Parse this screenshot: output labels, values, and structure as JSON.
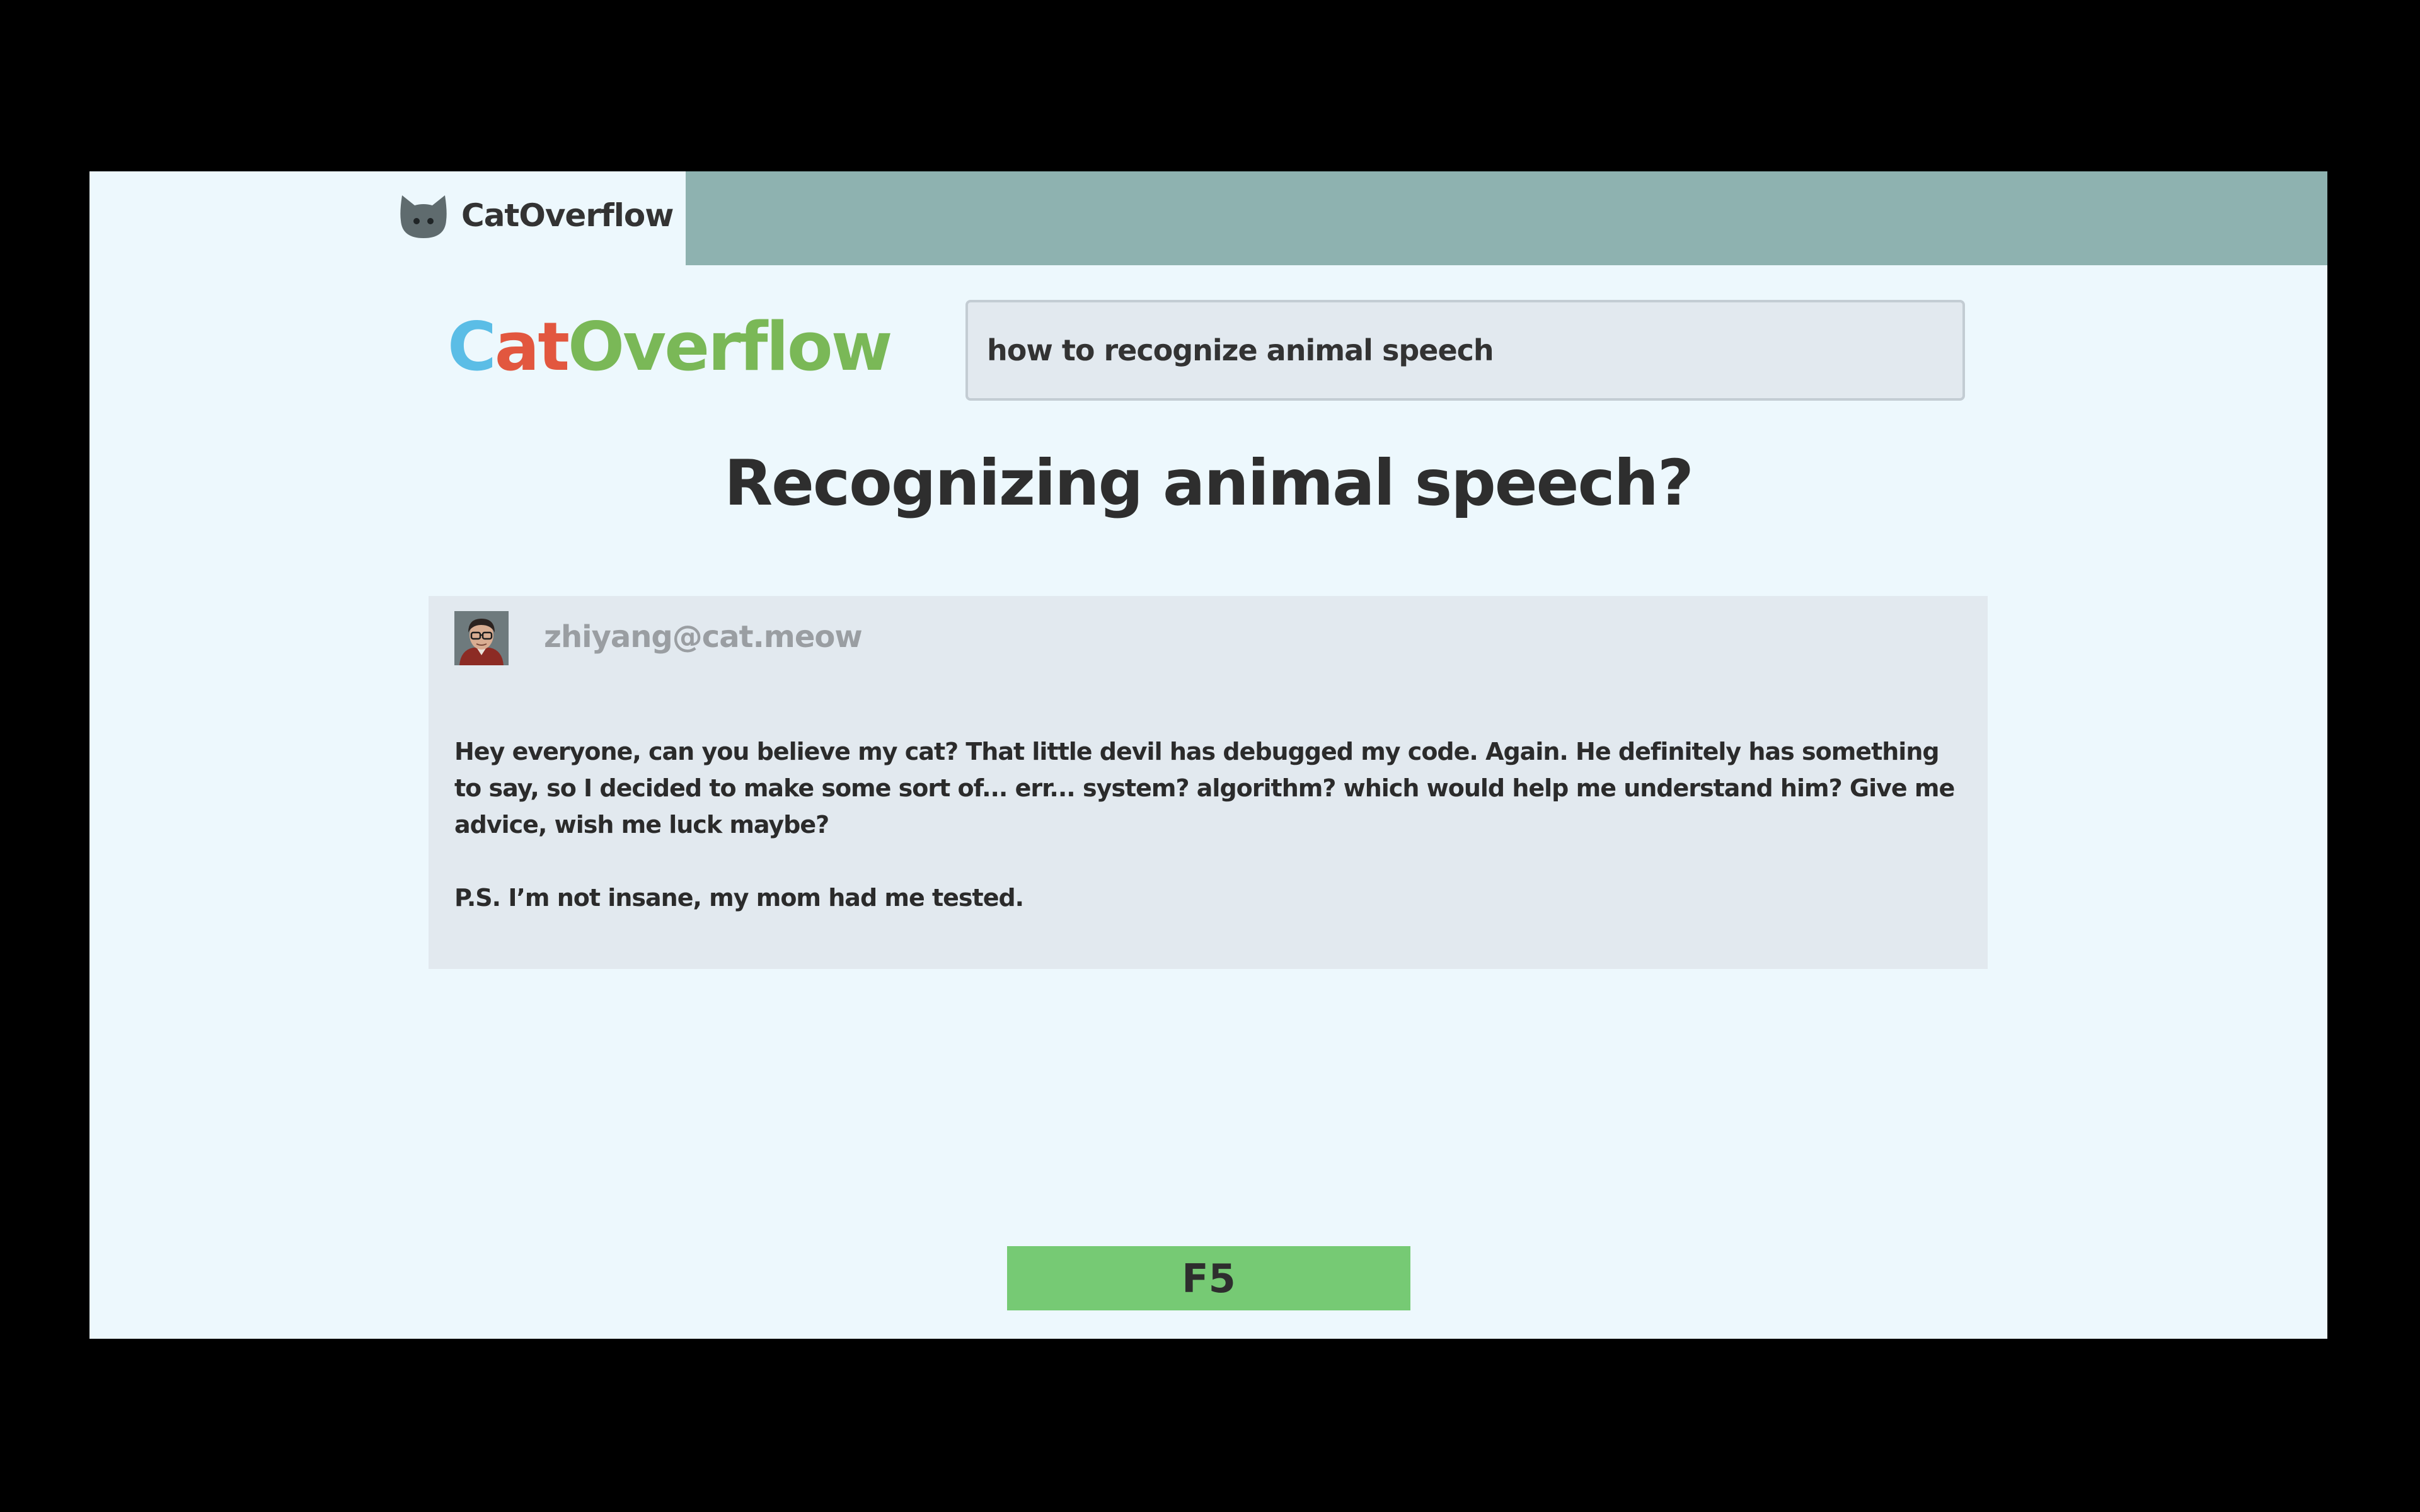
{
  "tab": {
    "title": "CatOverflow",
    "icon": "cat-head-icon"
  },
  "logo": {
    "part1": "C",
    "part2": "at",
    "part3": "Overflow",
    "colors": {
      "part1": "#5bbde6",
      "part2": "#e2573f",
      "part3": "#7ab857"
    }
  },
  "search": {
    "value": "how to recognize animal speech"
  },
  "question": {
    "title": "Recognizing animal speech?"
  },
  "post": {
    "author": "zhiyang@cat.meow",
    "avatar": "avatar-icon",
    "paragraphs": [
      "Hey everyone, can you believe my cat? That little devil has debugged my code. Again. He definitely has something to say, so I decided to make some sort of... err... system? algorithm? which would help me understand him? Give me advice, wish me luck maybe?",
      "P.S. I’m not insane, my mom had me tested."
    ]
  },
  "refresh": {
    "label": "F5"
  },
  "theme": {
    "background": "#edf8fd",
    "tabbar": "#8eb2b0",
    "card": "#e2e9ef",
    "button": "#76ca74"
  }
}
